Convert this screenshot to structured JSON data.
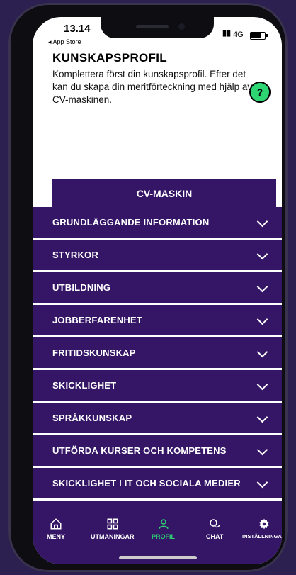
{
  "status": {
    "time": "13.14",
    "back_label": "◂ App Store",
    "network": "4G",
    "signal": "▮▮"
  },
  "profile": {
    "title": "KUNSKAPSPROFIL",
    "description": "Komplettera först din kunskapsprofil. Efter det kan du skapa din meritförteckning med hjälp av CV-maskinen.",
    "help_label": "?",
    "cv_button": "CV-MASKIN"
  },
  "sections": [
    {
      "label": "GRUNDLÄGGANDE INFORMATION"
    },
    {
      "label": "STYRKOR"
    },
    {
      "label": "UTBILDNING"
    },
    {
      "label": "JOBBERFARENHET"
    },
    {
      "label": "FRITIDSKUNSKAP"
    },
    {
      "label": "SKICKLIGHET"
    },
    {
      "label": "SPRÅKKUNSKAP"
    },
    {
      "label": "UTFÖRDA KURSER OCH KOMPETENS"
    },
    {
      "label": "SKICKLIGHET I IT OCH SOCIALA MEDIER"
    }
  ],
  "tabs": [
    {
      "label": "MENY",
      "icon": "home-icon"
    },
    {
      "label": "UTMANINGAR",
      "icon": "grid-icon"
    },
    {
      "label": "PROFIL",
      "icon": "person-icon"
    },
    {
      "label": "CHAT",
      "icon": "chat-icon"
    },
    {
      "label": "INSTÄLLNINGAR",
      "icon": "gear-icon"
    }
  ],
  "colors": {
    "primary": "#341566",
    "accent": "#2ed573",
    "background": "#ffffff"
  }
}
